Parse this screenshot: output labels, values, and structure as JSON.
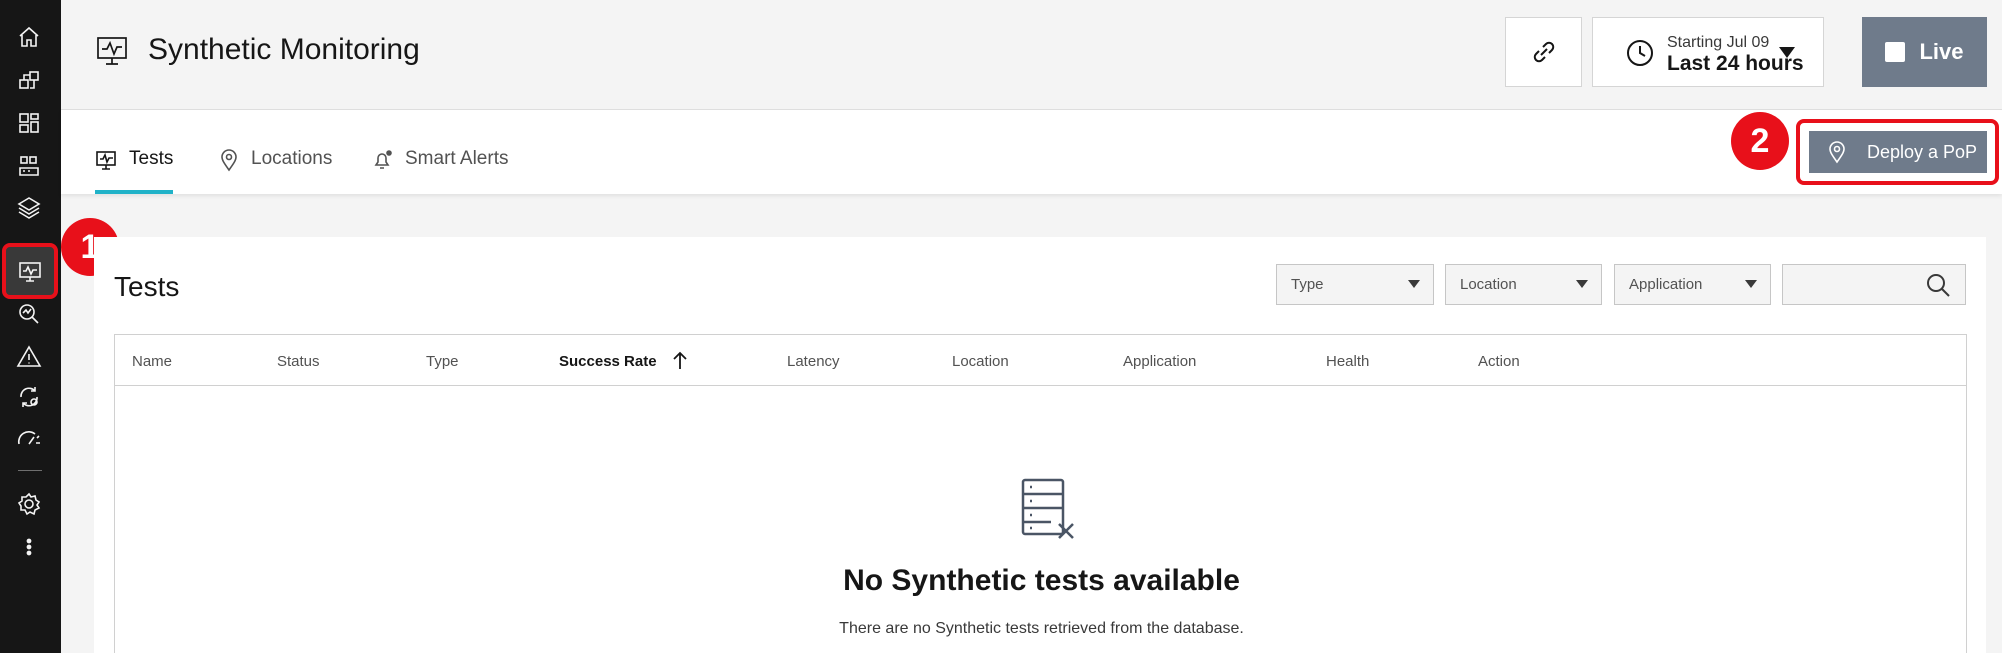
{
  "rail": {
    "items": [
      {
        "name": "home",
        "icon": "home-icon"
      },
      {
        "name": "applications",
        "icon": "applications-icon"
      },
      {
        "name": "dashboards",
        "icon": "dashboard-icon"
      },
      {
        "name": "infrastructure",
        "icon": "infrastructure-icon"
      },
      {
        "name": "platforms",
        "icon": "layers-icon"
      },
      {
        "name": "synthetic-monitoring",
        "icon": "synthetic-monitor-icon",
        "active": true
      },
      {
        "name": "analytics",
        "icon": "analytics-icon"
      },
      {
        "name": "events",
        "icon": "warning-icon"
      },
      {
        "name": "automation",
        "icon": "automation-icon"
      },
      {
        "name": "slo",
        "icon": "gauge-icon"
      },
      {
        "name": "settings",
        "icon": "gear-icon"
      },
      {
        "name": "more",
        "icon": "overflow-menu-icon"
      }
    ]
  },
  "header": {
    "title": "Synthetic Monitoring",
    "time_range": {
      "starting": "Starting Jul 09",
      "label": "Last 24 hours"
    },
    "live_label": "Live"
  },
  "tabs": [
    {
      "label": "Tests",
      "active": true
    },
    {
      "label": "Locations"
    },
    {
      "label": "Smart Alerts"
    }
  ],
  "deploy_button": "Deploy a PoP",
  "callouts": [
    "1",
    "2"
  ],
  "panel": {
    "title": "Tests",
    "filters": {
      "type": "Type",
      "location": "Location",
      "application": "Application",
      "search_placeholder": ""
    },
    "columns": [
      "Name",
      "Status",
      "Type",
      "Success Rate",
      "Latency",
      "Location",
      "Application",
      "Health",
      "Action"
    ],
    "sorted_column": "Success Rate",
    "empty_title": "No Synthetic tests available",
    "empty_subtitle": "There are no Synthetic tests retrieved from the database."
  },
  "colors": {
    "accent": "#20b2c8",
    "callout": "#e8101a",
    "button": "#6f7b8b",
    "rail": "#161616"
  }
}
